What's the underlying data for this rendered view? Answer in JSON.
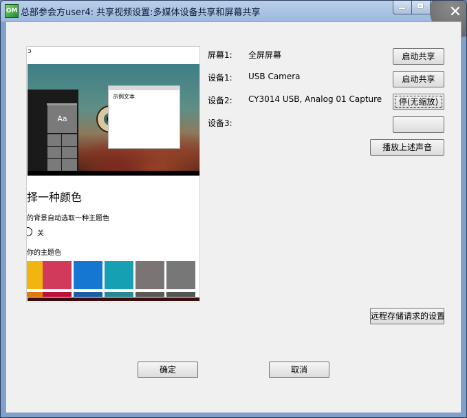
{
  "window": {
    "title": "总部参会方user4: 共享视频设置:多媒体设备共享和屏幕共享",
    "app_icon_text": "OM"
  },
  "devices": [
    {
      "label": "屏幕1:",
      "value": "全屏屏幕",
      "button": "启动共享"
    },
    {
      "label": "设备1:",
      "value": "USB Camera",
      "button": "启动共享"
    },
    {
      "label": "设备2:",
      "value": "CY3014 USB, Analog 01 Capture",
      "button": "停(无缩放)"
    },
    {
      "label": "设备3:",
      "value": "",
      "button": ""
    }
  ],
  "buttons": {
    "play_audio": "播放上述声音",
    "remote_storage": "远程存储请求的设置",
    "ok": "确定",
    "cancel": "取消"
  },
  "preview": {
    "refresh_glyph": "ↄ",
    "dialog_text": "示例文本",
    "tile_text": "Aa",
    "heading": "择一种颜色",
    "auto_pick_text": "的背景自动选取一种主题色",
    "toggle_label": "关",
    "theme_label": "你的主题色",
    "swatch_colors": [
      "#f2b50f",
      "#d13a5b",
      "#1677d2",
      "#16a0b4",
      "#7a7474",
      "#777777"
    ],
    "swatch_bottom_colors": [
      "#e07a10",
      "#c0103a",
      "#1a5ea8",
      "#2a8894",
      "#5d5858",
      "#555555"
    ]
  }
}
